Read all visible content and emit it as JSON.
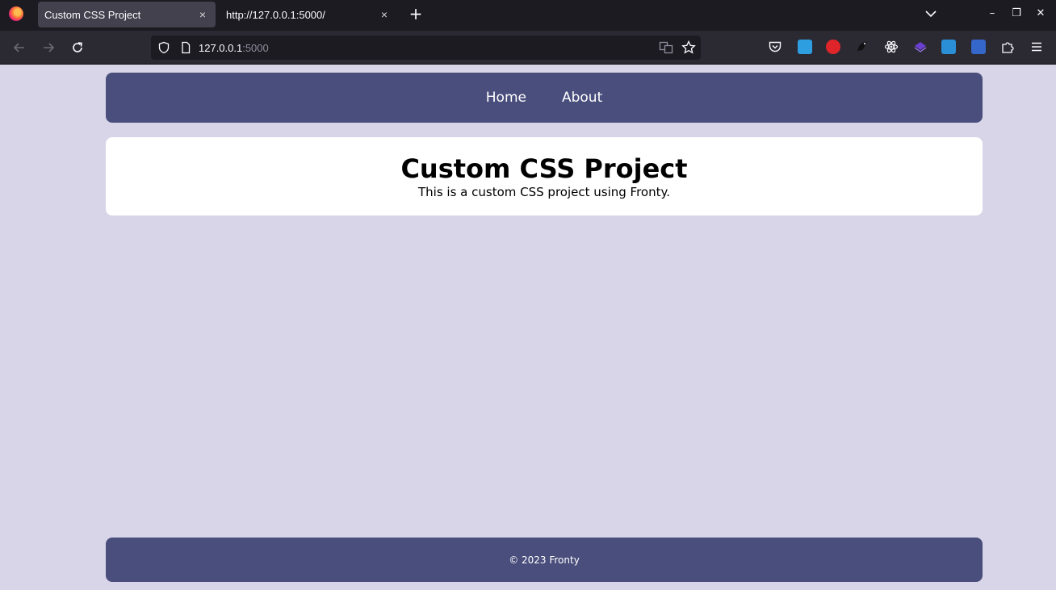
{
  "browser": {
    "tabs": [
      {
        "title": "Custom CSS Project",
        "active": true
      },
      {
        "title": "http://127.0.0.1:5000/",
        "active": false
      }
    ],
    "url_host": "127.0.0.1",
    "url_port": ":5000",
    "icons": {
      "firefox": "firefox-logo-icon",
      "close": "×",
      "new_tab": "+",
      "minimize": "–",
      "restore": "❐",
      "window_close": "✕"
    }
  },
  "site": {
    "nav": [
      {
        "label": "Home"
      },
      {
        "label": "About"
      }
    ],
    "hero": {
      "title": "Custom CSS Project",
      "subtitle": "This is a custom CSS project using Fronty."
    },
    "footer": "© 2023 Fronty"
  },
  "colors": {
    "page_bg": "#d7d5e7",
    "nav_bg": "#4a4e7c",
    "card_bg": "#ffffff"
  }
}
